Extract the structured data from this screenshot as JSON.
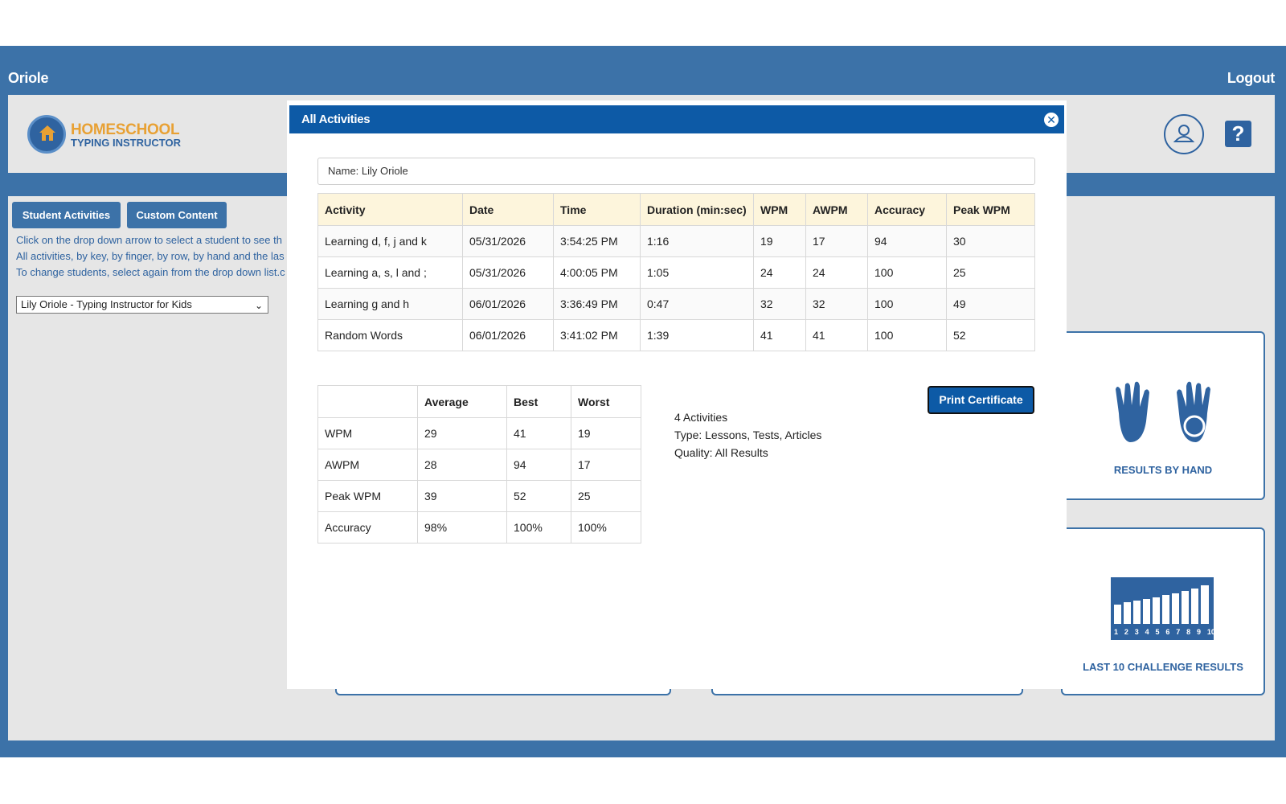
{
  "topbar": {
    "title": "Oriole",
    "logout": "Logout"
  },
  "logo": {
    "line1": "HOMESCHOOL",
    "line2": "TYPING INSTRUCTOR"
  },
  "header": {
    "help_glyph": "?"
  },
  "tabs": [
    {
      "label": "Student Activities"
    },
    {
      "label": "Custom Content"
    }
  ],
  "instructions": [
    "Click on the drop down arrow to select a student to see th",
    "All activities, by key, by finger, by row, by hand and the las",
    "To change students, select again from the drop down list.c"
  ],
  "student_select": {
    "value": "Lily Oriole - Typing Instructor for Kids"
  },
  "cards": {
    "results_by_hand": "RESULTS BY HAND",
    "last_10": "LAST 10 CHALLENGE RESULTS",
    "last_10_bars": [
      "1",
      "2",
      "3",
      "4",
      "5",
      "6",
      "7",
      "8",
      "9",
      "10"
    ]
  },
  "modal": {
    "title": "All Activities",
    "name_field": "Name: Lily Oriole",
    "activity_headers": [
      "Activity",
      "Date",
      "Time",
      "Duration (min:sec)",
      "WPM",
      "AWPM",
      "Accuracy",
      "Peak WPM"
    ],
    "activities": [
      [
        "Learning d, f, j and k",
        "05/31/2026",
        "3:54:25 PM",
        "1:16",
        "19",
        "17",
        "94",
        "30"
      ],
      [
        "Learning a, s, l and ;",
        "05/31/2026",
        "4:00:05 PM",
        "1:05",
        "24",
        "24",
        "100",
        "25"
      ],
      [
        "Learning g and h",
        "06/01/2026",
        "3:36:49 PM",
        "0:47",
        "32",
        "32",
        "100",
        "49"
      ],
      [
        "Random Words",
        "06/01/2026",
        "3:41:02 PM",
        "1:39",
        "41",
        "41",
        "100",
        "52"
      ]
    ],
    "summary_headers": [
      "",
      "Average",
      "Best",
      "Worst"
    ],
    "summary": [
      [
        "WPM",
        "29",
        "41",
        "19"
      ],
      [
        "AWPM",
        "28",
        "94",
        "17"
      ],
      [
        "Peak WPM",
        "39",
        "52",
        "25"
      ],
      [
        "Accuracy",
        "98%",
        "100%",
        "100%"
      ]
    ],
    "print_button": "Print Certificate",
    "info": [
      "4 Activities",
      "Type: Lessons, Tests, Articles",
      "Quality: All Results"
    ]
  },
  "colors": {
    "frame": "#3c72a8",
    "modal_header": "#0d5aa6",
    "table_header": "#fdf5dc",
    "logo_orange": "#e8a134"
  }
}
